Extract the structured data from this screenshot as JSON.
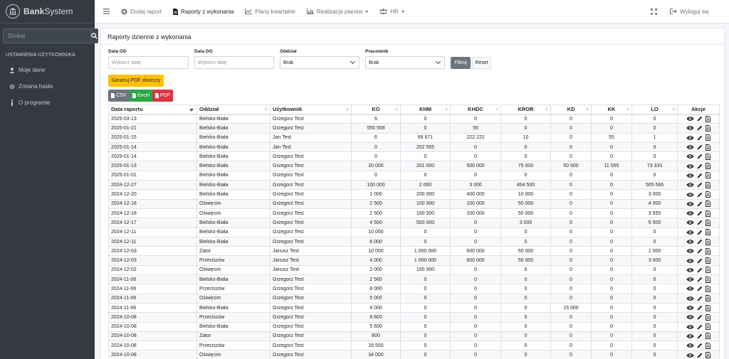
{
  "brand": {
    "name_bold": "Bank",
    "name_rest": "System"
  },
  "sidebar": {
    "search_placeholder": "Szukaj",
    "section_header": "USTAWIENIA UŻYTKOWNIKA",
    "items": [
      {
        "label": "Moje dane",
        "icon": "user-icon"
      },
      {
        "label": "Zmiana hasła",
        "icon": "gear-icon"
      },
      {
        "label": "O programie",
        "icon": "info-icon"
      }
    ]
  },
  "topnav": {
    "items": [
      {
        "label": "Dodaj raport",
        "icon": "plus-circle-icon"
      },
      {
        "label": "Raporty z wykonania",
        "icon": "file-icon"
      },
      {
        "label": "Plany kwartalne",
        "icon": "line-chart-icon"
      },
      {
        "label": "Realizacja planów",
        "icon": "bar-chart-icon"
      },
      {
        "label": "HR",
        "icon": "users-icon"
      }
    ],
    "logout": "Wyloguj się"
  },
  "card": {
    "title": "Raporty dzienne z wykonania",
    "filters": {
      "date_from_label": "Data OD",
      "date_to_label": "Data DO",
      "branch_label": "Oddział",
      "employee_label": "Pracownik",
      "date_placeholder": "Wybierz datę",
      "branch_value": "Brak",
      "employee_value": "Brak",
      "filter_btn": "Filtruj",
      "reset_btn": "Reset"
    },
    "pdf_summary_btn": "Generuj PDF zbiorczy",
    "export": {
      "csv": "CSV",
      "excel": "Excel",
      "pdf": "PDF"
    }
  },
  "table": {
    "headers": [
      "Data raportu",
      "Oddział",
      "Użytkownik",
      "KG",
      "KHM",
      "KHDC",
      "KROR",
      "KD",
      "KK",
      "LO",
      "Akcje"
    ],
    "rows": [
      [
        "2025-03-13",
        "Bielsko-Biała",
        "Grzegorz Test",
        "6",
        "0",
        "0",
        "0",
        "0",
        "0",
        "0"
      ],
      [
        "2025-01-21",
        "Bielsko-Biała",
        "Grzegorz Test",
        "555 558",
        "0",
        "55",
        "0",
        "0",
        "0",
        "0"
      ],
      [
        "2025-01-15",
        "Bielsko-Biała",
        "Jan Test",
        "6",
        "66 671",
        "222 222",
        "10",
        "0",
        "55",
        "1"
      ],
      [
        "2025-01-14",
        "Bielsko-Biała",
        "Jan Test",
        "0",
        "252 555",
        "0",
        "0",
        "0",
        "0",
        "0"
      ],
      [
        "2025-01-14",
        "Bielsko-Biała",
        "Grzegorz Test",
        "0",
        "0",
        "0",
        "0",
        "0",
        "0",
        "0"
      ],
      [
        "2025-01-13",
        "Bielsko-Biała",
        "Grzegorz Test",
        "20 000",
        "201 000",
        "500 000",
        "75 000",
        "50 500",
        "11 555",
        "73 333"
      ],
      [
        "2025-01-01",
        "Bielsko-Biała",
        "Grzegorz Test",
        "0",
        "0",
        "0",
        "0",
        "0",
        "0",
        "0"
      ],
      [
        "2024-12-27",
        "Bielsko-Biała",
        "Grzegorz Test",
        "100 000",
        "2 000",
        "3 000",
        "404 500",
        "0",
        "0",
        "505 566"
      ],
      [
        "2024-12-20",
        "Bielsko-Biała",
        "Grzegorz Test",
        "1 000",
        "200 000",
        "400 000",
        "10 000",
        "0",
        "0",
        "3 000"
      ],
      [
        "2024-12-18",
        "Oświęcim",
        "Grzegorz Test",
        "2 500",
        "100 000",
        "100 000",
        "50 000",
        "0",
        "0",
        "4 000"
      ],
      [
        "2024-12-18",
        "Oświęcim",
        "Grzegorz Test",
        "2 500",
        "100 000",
        "100 000",
        "50 000",
        "0",
        "0",
        "3 555"
      ],
      [
        "2024-12-17",
        "Bielsko-Biała",
        "Grzegorz Test",
        "4 500",
        "500 000",
        "0",
        "3 000",
        "0",
        "0",
        "5 500"
      ],
      [
        "2024-12-11",
        "Bielsko-Biała",
        "Grzegorz Test",
        "10 000",
        "0",
        "0",
        "0",
        "0",
        "0",
        "0"
      ],
      [
        "2024-12-11",
        "Bielsko-Biała",
        "Grzegorz Test",
        "6 000",
        "0",
        "0",
        "0",
        "0",
        "0",
        "0"
      ],
      [
        "2024-12-03",
        "Zator",
        "Janusz Test",
        "10 000",
        "1 000 000",
        "600 000",
        "50 000",
        "0",
        "0",
        "1 000"
      ],
      [
        "2024-12-03",
        "Przeciszów",
        "Janusz Test",
        "4 000",
        "1 000 000",
        "600 000",
        "50 000",
        "0",
        "0",
        "3 000"
      ],
      [
        "2024-12-02",
        "Oświęcim",
        "Janusz Test",
        "2 000",
        "100 000",
        "0",
        "0",
        "0",
        "0",
        "0"
      ],
      [
        "2024-11-06",
        "Bielsko-Biała",
        "Grzegorz Test",
        "2 560",
        "0",
        "0",
        "0",
        "0",
        "0",
        "0"
      ],
      [
        "2024-11-06",
        "Przeciszów",
        "Grzegorz Test",
        "8 000",
        "0",
        "0",
        "0",
        "0",
        "0",
        "0"
      ],
      [
        "2024-11-06",
        "Oświęcim",
        "Grzegorz Test",
        "5 000",
        "0",
        "0",
        "0",
        "0",
        "0",
        "0"
      ],
      [
        "2024-11-06",
        "Bielsko-Biała",
        "Grzegorz Test",
        "4 000",
        "0",
        "0",
        "0",
        "15 000",
        "0",
        "0"
      ],
      [
        "2024-10-08",
        "Przeciszów",
        "Grzegorz Test",
        "9 800",
        "0",
        "0",
        "0",
        "0",
        "0",
        "0"
      ],
      [
        "2024-10-08",
        "Bielsko-Biała",
        "Grzegorz Test",
        "5 600",
        "0",
        "0",
        "0",
        "0",
        "0",
        "0"
      ],
      [
        "2024-10-08",
        "Zator",
        "Grzegorz Test",
        "800",
        "0",
        "0",
        "0",
        "0",
        "0",
        "0"
      ],
      [
        "2024-10-08",
        "Przeciszów",
        "Grzegorz Test",
        "16 500",
        "0",
        "0",
        "0",
        "0",
        "0",
        "0"
      ],
      [
        "2024-10-08",
        "Oświęcim",
        "Grzegorz Test",
        "34 000",
        "0",
        "0",
        "0",
        "0",
        "0",
        "0"
      ]
    ]
  }
}
